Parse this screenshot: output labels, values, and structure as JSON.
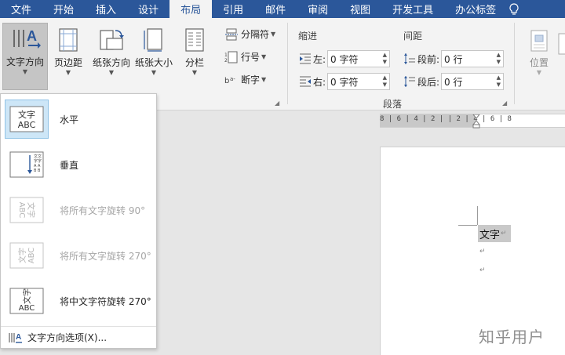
{
  "tabs": [
    "文件",
    "开始",
    "插入",
    "设计",
    "布局",
    "引用",
    "邮件",
    "审阅",
    "视图",
    "开发工具",
    "办公标签"
  ],
  "active_tab": "布局",
  "ribbon": {
    "page_setup": {
      "text_direction": "文字方向",
      "margins": "页边距",
      "orientation": "纸张方向",
      "size": "纸张大小",
      "columns": "分栏",
      "breaks": "分隔符",
      "line_numbers": "行号",
      "hyphenation": "断字"
    },
    "paragraph": {
      "indent_label": "缩进",
      "spacing_label": "间距",
      "left_label": "左:",
      "left_value": "0 字符",
      "right_label": "右:",
      "right_value": "0 字符",
      "before_label": "段前:",
      "before_value": "0 行",
      "after_label": "段后:",
      "after_value": "0 行",
      "group_label": "段落"
    },
    "arrange": {
      "position": "位置"
    }
  },
  "menu": {
    "items": [
      {
        "label": "水平",
        "thumb": "文字\nABC",
        "state": "selected"
      },
      {
        "label": "垂直",
        "state": "enabled"
      },
      {
        "label": "将所有文字旋转 90°",
        "state": "disabled"
      },
      {
        "label": "将所有文字旋转 270°",
        "state": "disabled"
      },
      {
        "label": "将中文字符旋转 270°",
        "state": "enabled"
      }
    ],
    "thumb_text": {
      "cn": "文字",
      "en": "ABC"
    },
    "footer": "文字方向选项(X)..."
  },
  "ruler": {
    "numbers": "8 | 6 | 4 | 2 |   | 2 | 4 | 6 | 8"
  },
  "document": {
    "selected_text": "文字",
    "para_mark": "↵"
  },
  "watermark": "知乎用户",
  "colors": {
    "accent": "#2b579a",
    "ribbon": "#f3f3f3",
    "selected": "#cde6f7"
  }
}
